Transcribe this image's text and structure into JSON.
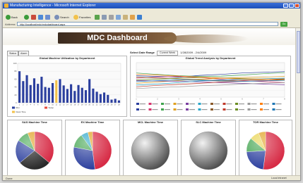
{
  "window": {
    "title": "Manufacturing Intelligence - Microsoft Internet Explorer"
  },
  "menu": [
    "File",
    "Edit",
    "View",
    "Favorites",
    "Tools",
    "Help"
  ],
  "toolbar": {
    "back": "Back",
    "search": "Search",
    "favorites": "Favorites"
  },
  "address": {
    "label": "Address",
    "url": "http://localhost/mdc/mdcdashboard.aspx",
    "go": "Go"
  },
  "dashboard": {
    "title": "MDC Dashboard",
    "tabs": [
      "Status",
      "Alarm"
    ],
    "date_range": {
      "label": "Select Date Range",
      "option": "Current Week",
      "start": "1/28/2009",
      "end": "2/4/2009"
    }
  },
  "colors": {
    "bar": "#2b3f9e",
    "bar_highlight": "#f2c24b",
    "banner": "#4a3424"
  },
  "chart_data": [
    {
      "type": "bar",
      "title": "Global Machine Utilization by Department",
      "categories": [
        "1",
        "2",
        "3",
        "4",
        "5",
        "6",
        "7",
        "8",
        "9",
        "10",
        "11",
        "12",
        "13",
        "14",
        "15",
        "16",
        "17",
        "18",
        "19",
        "20",
        "21",
        "22",
        "23",
        "24",
        "25",
        "26",
        "27",
        "28"
      ],
      "values": [
        80,
        55,
        70,
        45,
        62,
        48,
        66,
        40,
        38,
        50,
        57,
        60,
        44,
        35,
        47,
        30,
        45,
        38,
        32,
        60,
        36,
        28,
        22,
        26,
        20,
        8,
        10,
        6
      ],
      "highlight_index": 10,
      "ylim": [
        0,
        100
      ],
      "legend": [
        "Run",
        "Setup",
        "Down Time"
      ]
    },
    {
      "type": "line",
      "title": "Global Trend Analysis by Department",
      "x": [
        "1",
        "2",
        "3",
        "4",
        "5",
        "6",
        "7",
        "8"
      ],
      "series": [
        {
          "color": "#2b3f9e",
          "values": [
            62,
            60,
            58,
            63,
            66,
            70,
            72,
            74
          ]
        },
        {
          "color": "#d6336c",
          "values": [
            55,
            58,
            60,
            57,
            52,
            48,
            45,
            42
          ]
        },
        {
          "color": "#3fa34d",
          "values": [
            70,
            66,
            62,
            60,
            61,
            64,
            68,
            71
          ]
        },
        {
          "color": "#e0a020",
          "values": [
            40,
            44,
            48,
            52,
            55,
            57,
            58,
            60
          ]
        },
        {
          "color": "#7b3fa0",
          "values": [
            48,
            47,
            46,
            44,
            42,
            40,
            38,
            36
          ]
        },
        {
          "color": "#2aa6c9",
          "values": [
            35,
            38,
            42,
            47,
            50,
            52,
            53,
            55
          ]
        },
        {
          "color": "#8a5a2b",
          "values": [
            58,
            55,
            53,
            50,
            48,
            49,
            51,
            53
          ]
        },
        {
          "color": "#c0392b",
          "values": [
            30,
            34,
            37,
            40,
            44,
            46,
            48,
            50
          ]
        },
        {
          "color": "#6b8e23",
          "values": [
            50,
            52,
            55,
            57,
            56,
            54,
            52,
            50
          ]
        },
        {
          "color": "#999999",
          "values": [
            25,
            28,
            30,
            33,
            35,
            38,
            40,
            42
          ]
        },
        {
          "color": "#ff7f0e",
          "values": [
            66,
            64,
            61,
            58,
            55,
            53,
            52,
            51
          ]
        },
        {
          "color": "#1f77b4",
          "values": [
            45,
            48,
            50,
            49,
            47,
            46,
            47,
            49
          ]
        }
      ],
      "ylim": [
        0,
        100
      ],
      "legend_count": 24
    },
    {
      "type": "pie",
      "title": "SAS Machine Time",
      "slices": [
        {
          "value": 36,
          "color": "#d72c46"
        },
        {
          "value": 28,
          "color": "#2a2a2a"
        },
        {
          "value": 20,
          "color": "#2b3f9e"
        },
        {
          "value": 10,
          "color": "#3fa34d"
        },
        {
          "value": 6,
          "color": "#e0a020"
        }
      ]
    },
    {
      "type": "pie",
      "title": "EX Machine Time",
      "slices": [
        {
          "value": 48,
          "color": "#d72c46"
        },
        {
          "value": 30,
          "color": "#2b3f9e"
        },
        {
          "value": 12,
          "color": "#3fa34d"
        },
        {
          "value": 6,
          "color": "#2aa6c9"
        },
        {
          "value": 4,
          "color": "#e0a020"
        }
      ]
    },
    {
      "type": "pie",
      "title": "MCL Machine Time",
      "slices": [
        {
          "value": 100,
          "color": "#4a4a4a"
        }
      ]
    },
    {
      "type": "pie",
      "title": "SLC Machine Time",
      "slices": [
        {
          "value": 100,
          "color": "#4a4a4a"
        }
      ]
    },
    {
      "type": "pie",
      "title": "TOR Machine Time",
      "slices": [
        {
          "value": 52,
          "color": "#d72c46"
        },
        {
          "value": 22,
          "color": "#2b3f9e"
        },
        {
          "value": 12,
          "color": "#3fa34d"
        },
        {
          "value": 8,
          "color": "#e8d24a"
        },
        {
          "value": 6,
          "color": "#e0a020"
        }
      ]
    }
  ],
  "status": {
    "text": "Done",
    "zone": "Local intranet"
  }
}
